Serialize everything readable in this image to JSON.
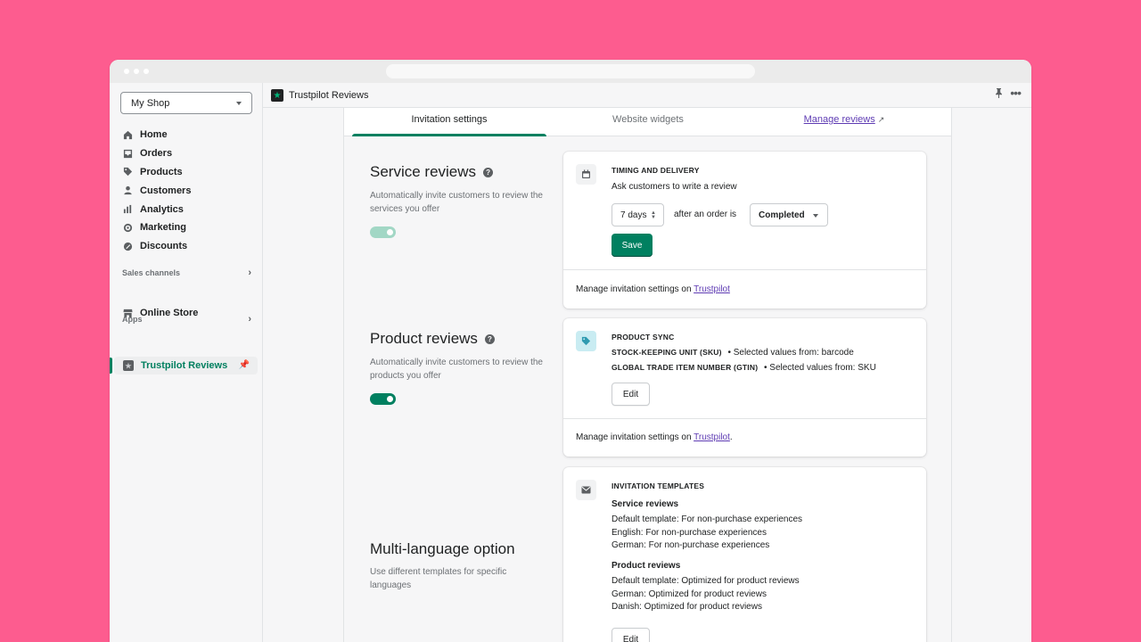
{
  "sidebar": {
    "shop": "My Shop",
    "nav": [
      {
        "label": "Home",
        "icon": "home-icon"
      },
      {
        "label": "Orders",
        "icon": "orders-icon"
      },
      {
        "label": "Products",
        "icon": "tag-icon"
      },
      {
        "label": "Customers",
        "icon": "person-icon"
      },
      {
        "label": "Analytics",
        "icon": "bar-chart-icon"
      },
      {
        "label": "Marketing",
        "icon": "target-icon"
      },
      {
        "label": "Discounts",
        "icon": "discount-icon"
      }
    ],
    "sales_channels_label": "Sales channels",
    "online_store": "Online Store",
    "apps_label": "Apps",
    "active_app": "Trustpilot Reviews"
  },
  "topbar": {
    "title": "Trustpilot Reviews"
  },
  "tabs": {
    "invitation": "Invitation settings",
    "widgets": "Website widgets",
    "manage": "Manage reviews"
  },
  "service": {
    "title": "Service reviews",
    "desc": "Automatically invite customers to review the services you offer",
    "enabled": true
  },
  "product": {
    "title": "Product reviews",
    "desc": "Automatically invite customers to review the products you offer",
    "enabled": true
  },
  "multilang": {
    "title": "Multi-language option",
    "desc": "Use different templates for specific languages"
  },
  "timing_card": {
    "heading": "TIMING AND DELIVERY",
    "subtitle": "Ask customers to write a review",
    "days_value": "7 days",
    "after_text": "after an order is",
    "status_value": "Completed",
    "save": "Save",
    "footer_text": "Manage invitation settings on ",
    "footer_link": "Trustpilot"
  },
  "sync_card": {
    "heading": "PRODUCT SYNC",
    "sku_label": "STOCK-KEEPING UNIT (SKU)",
    "sku_value": "• Selected values from: barcode",
    "gtin_label": "GLOBAL TRADE ITEM NUMBER (GTIN)",
    "gtin_value": "• Selected values from: SKU",
    "edit": "Edit",
    "footer_text": "Manage invitation settings on ",
    "footer_link": "Trustpilot",
    "footer_end": "."
  },
  "templates_card": {
    "heading": "INVITATION TEMPLATES",
    "service_title": "Service reviews",
    "service_lines": [
      "Default template: For non-purchase experiences",
      "English: For non-purchase experiences",
      "German: For non-purchase experiences"
    ],
    "product_title": "Product reviews",
    "product_lines": [
      "Default template: Optimized for product reviews",
      "German: Optimized for product reviews",
      "Danish: Optimized for product reviews"
    ],
    "edit": "Edit"
  }
}
